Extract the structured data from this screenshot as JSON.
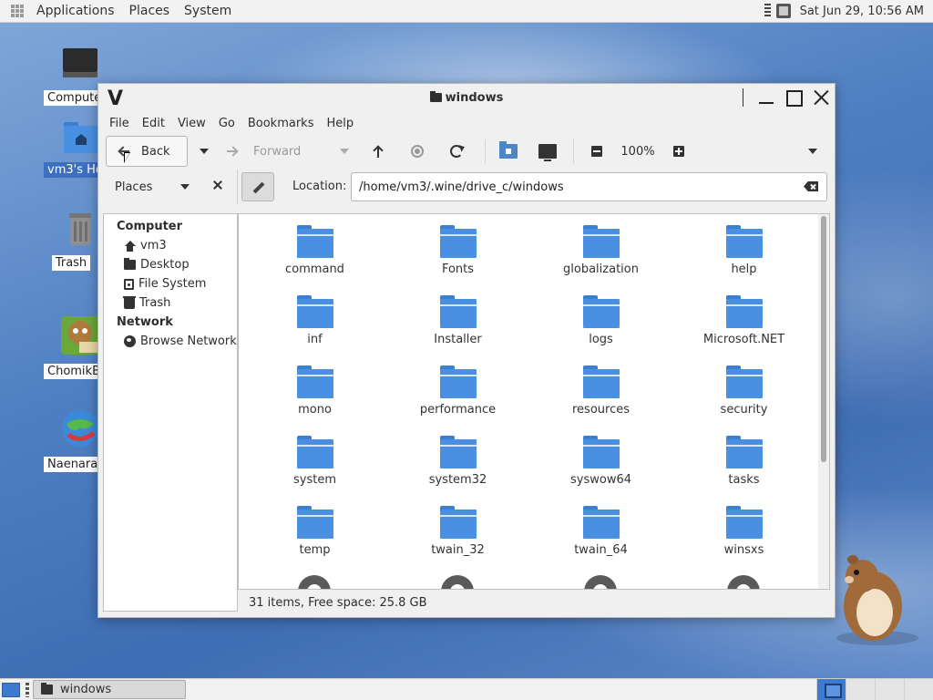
{
  "top_panel": {
    "menus": [
      "Applications",
      "Places",
      "System"
    ],
    "clock": "Sat Jun 29, 10:56 AM"
  },
  "desktop_icons": [
    {
      "label": "Computer",
      "icon": "computer-icon"
    },
    {
      "label": "vm3's Home",
      "icon": "home-folder-icon",
      "selected": true
    },
    {
      "label": "Trash",
      "icon": "trash-icon"
    },
    {
      "label": "ChomikBox",
      "icon": "chomikbox-icon"
    },
    {
      "label": "Naenara Browser",
      "icon": "browser-icon"
    }
  ],
  "window": {
    "title": "windows",
    "menu": [
      "File",
      "Edit",
      "View",
      "Go",
      "Bookmarks",
      "Help"
    ],
    "toolbar": {
      "back_label": "Back",
      "forward_label": "Forward",
      "zoom_level": "100%"
    },
    "places_header": "Places",
    "location_label": "Location:",
    "location_value": "/home/vm3/.wine/drive_c/windows",
    "sidebar": {
      "computer_section": "Computer",
      "computer_items": [
        {
          "label": "vm3",
          "icon": "home-icon"
        },
        {
          "label": "Desktop",
          "icon": "folder-icon"
        },
        {
          "label": "File System",
          "icon": "disk-icon"
        },
        {
          "label": "Trash",
          "icon": "trash-icon"
        }
      ],
      "network_section": "Network",
      "network_items": [
        {
          "label": "Browse Network",
          "icon": "globe-icon"
        }
      ]
    },
    "files": [
      "command",
      "Fonts",
      "globalization",
      "help",
      "inf",
      "Installer",
      "logs",
      "Microsoft.NET",
      "mono",
      "performance",
      "resources",
      "security",
      "system",
      "system32",
      "syswow64",
      "tasks",
      "temp",
      "twain_32",
      "twain_64",
      "winsxs"
    ],
    "status": "31 items, Free space: 25.8 GB"
  },
  "taskbar": {
    "task_label": "windows"
  },
  "colors": {
    "folder": "#4a90e2",
    "accent": "#3d7ad0"
  }
}
